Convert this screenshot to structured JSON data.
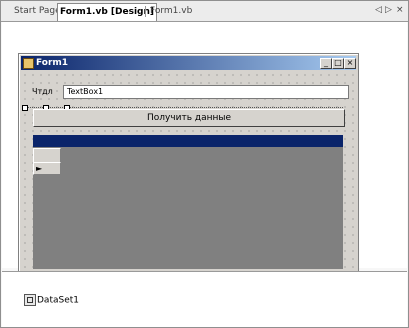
{
  "tabs": [
    {
      "label": "Start Page",
      "active": false
    },
    {
      "label": "Form1.vb [Design]",
      "active": true
    },
    {
      "label": "Form1.vb",
      "active": false
    }
  ],
  "nav": {
    "prev": "◁",
    "next": "▷",
    "close": "×"
  },
  "form": {
    "title": "Form1",
    "caption_buttons": {
      "minimize": "_",
      "maximize": "□",
      "close": "×"
    },
    "label_text": "Чтдл",
    "textbox_value": "TextBox1",
    "button_label": "Получить данные",
    "grid_row_marker": "►"
  },
  "tray": {
    "item_label": "DataSet1"
  },
  "colors": {
    "title_start": "#0a246a",
    "title_end": "#a6caf0",
    "form_bg": "#d6d3ce",
    "grid_bg": "#808080",
    "grid_caption": "#0a246a"
  }
}
